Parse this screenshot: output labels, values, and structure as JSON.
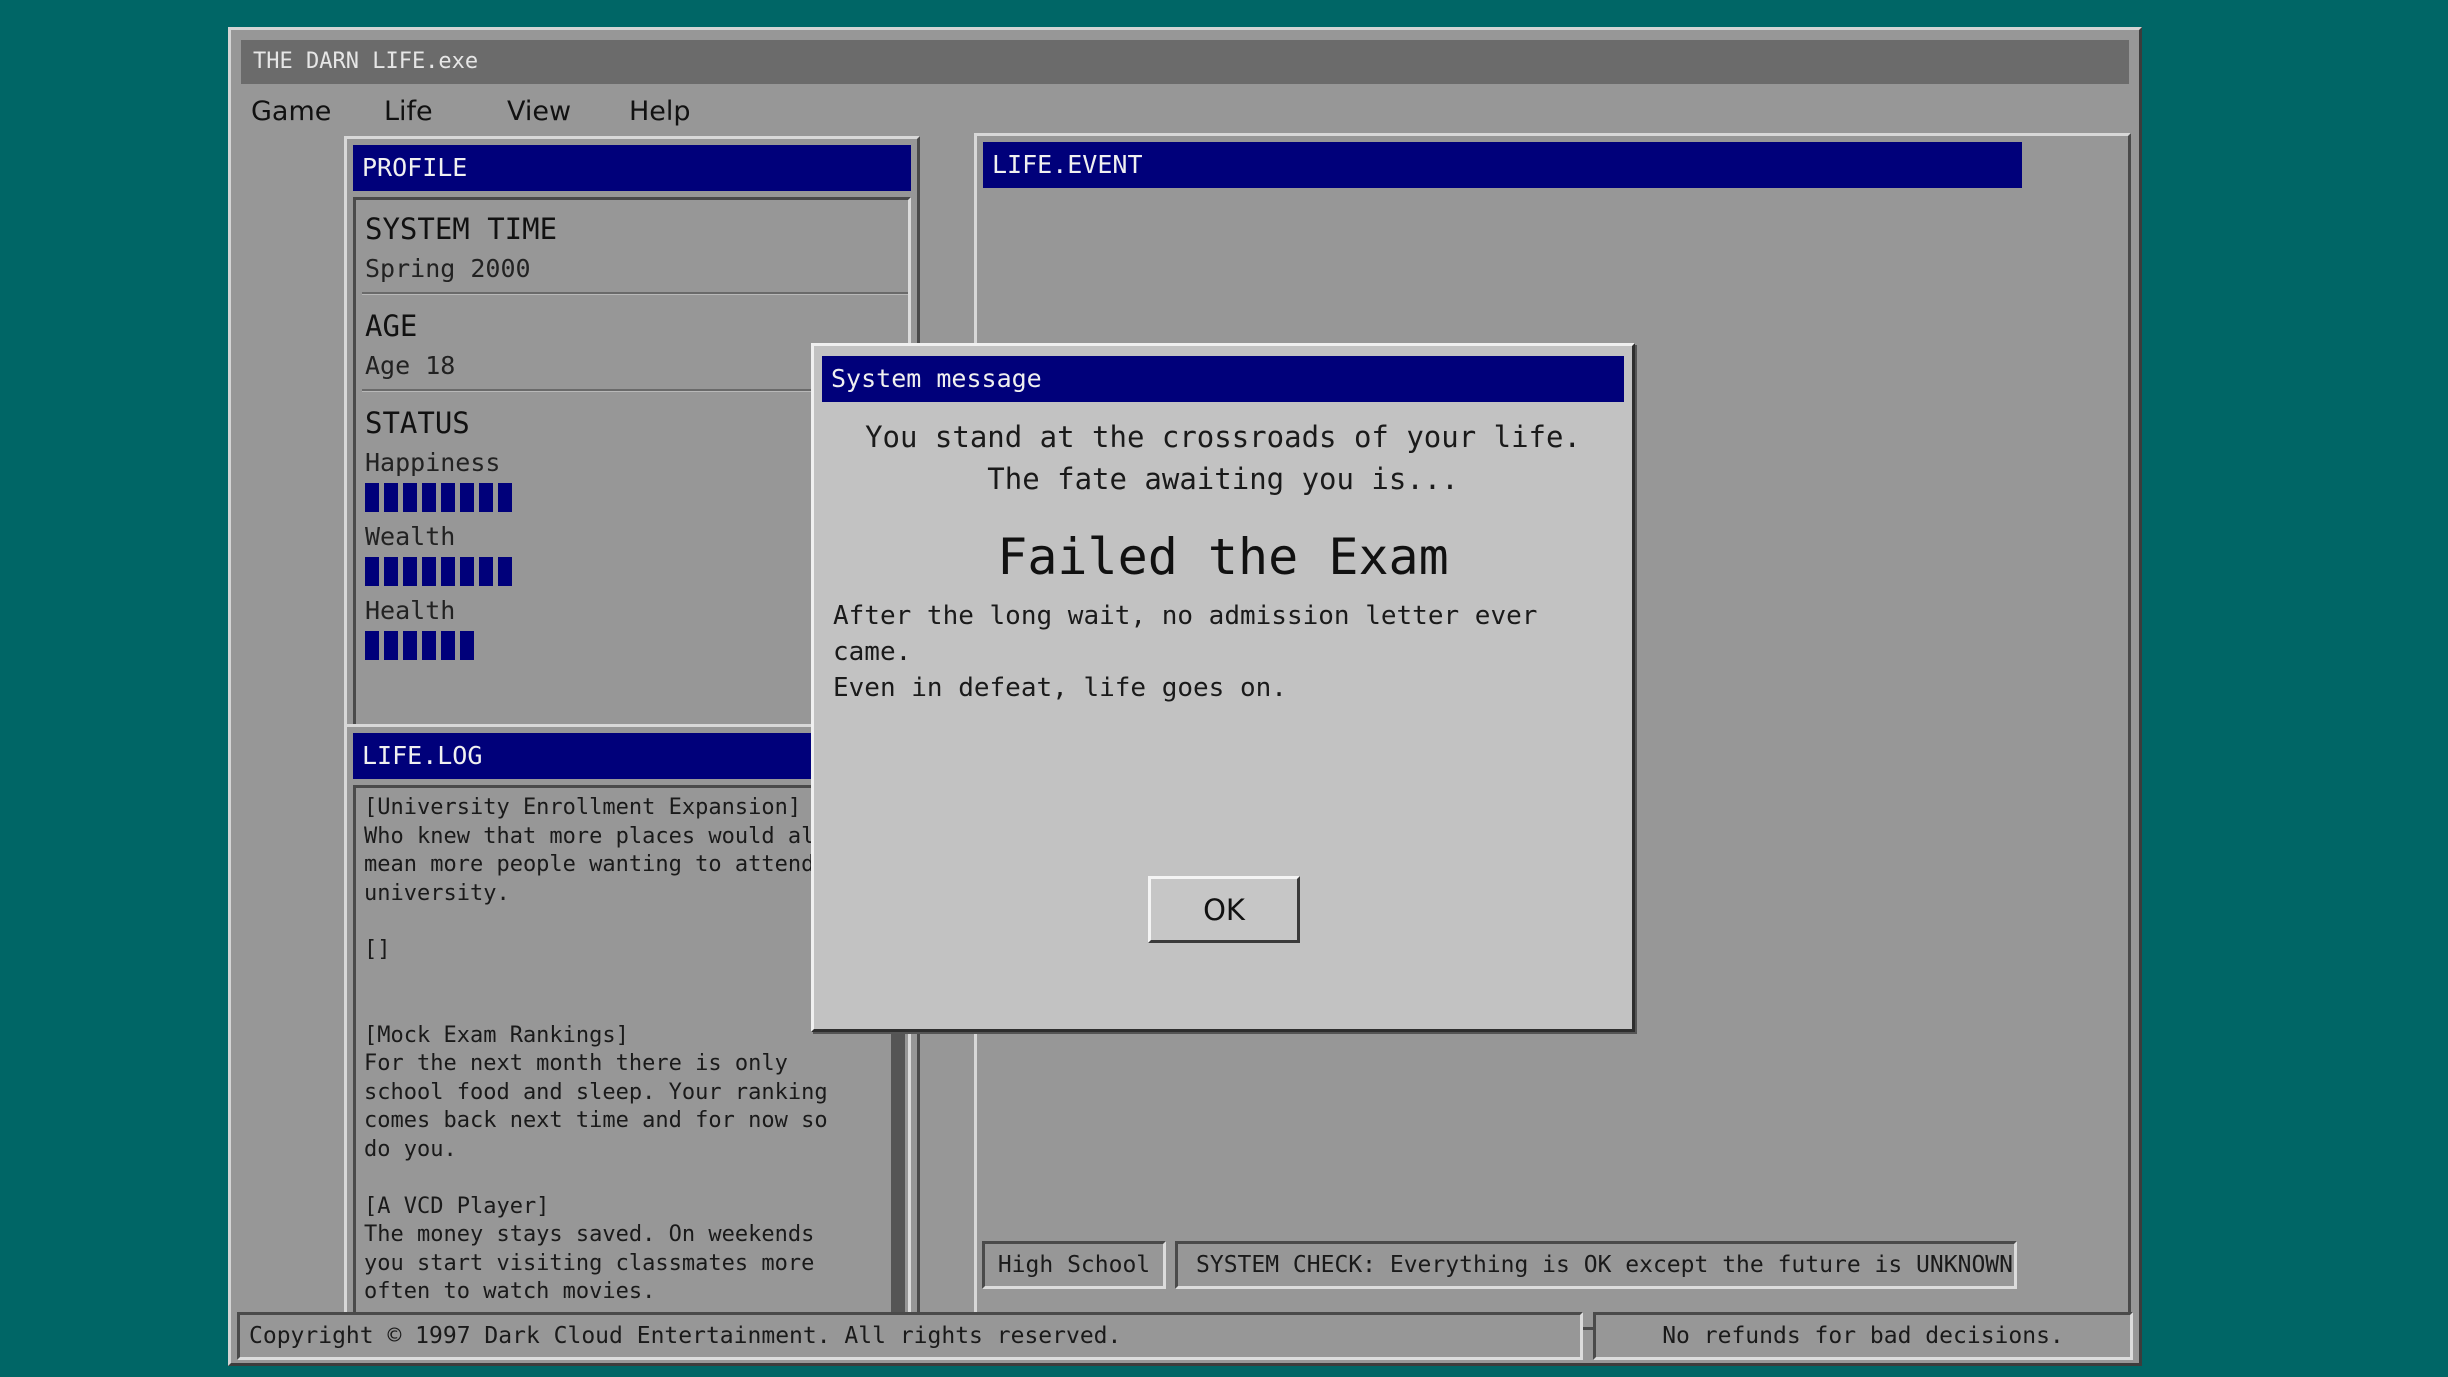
{
  "window": {
    "title": "THE DARN LIFE.exe"
  },
  "menu": [
    "Game",
    "Life",
    "View",
    "Help"
  ],
  "profile": {
    "header": "PROFILE",
    "system_time_title": "SYSTEM TIME",
    "system_time_value": "Spring 2000",
    "age_title": "AGE",
    "age_value": "Age 18",
    "status_title": "STATUS",
    "stats": [
      {
        "label": "Happiness",
        "segments": 8
      },
      {
        "label": "Wealth",
        "segments": 8
      },
      {
        "label": "Health",
        "segments": 6
      }
    ]
  },
  "log": {
    "header": "LIFE.LOG",
    "entries": [
      {
        "title": "[University Enrollment Expansion]",
        "body": "Who knew that more places would also\nmean more people wanting to attend\nuniversity."
      },
      {
        "title": "[]",
        "body": ""
      },
      {
        "title": "[Mock Exam Rankings]",
        "body": "For the next month there is only\nschool food and sleep. Your ranking\ncomes back next time and for now so\ndo you."
      },
      {
        "title": "[A VCD Player]",
        "body": "The money stays saved. On weekends\nyou start visiting classmates more\noften to watch movies."
      }
    ]
  },
  "event": {
    "header": "LIFE.EVENT",
    "stage": "High School",
    "system_check": "SYSTEM CHECK: Everything is OK except the future is UNKNOWN."
  },
  "dialog": {
    "title": "System message",
    "intro_line1": "You stand at the crossroads of your life.",
    "intro_line2": "The fate awaiting you is...",
    "outcome": "Failed the Exam",
    "desc_line1": "After the long wait, no admission letter ever came.",
    "desc_line2": "Even in defeat, life goes on.",
    "ok_label": "OK"
  },
  "footer": {
    "copyright": "Copyright © 1997 Dark Cloud Entertainment. All rights reserved.",
    "tagline": "No refunds for bad decisions."
  },
  "colors": {
    "desktop": "#006666",
    "title_bar_blue": "#00007a",
    "window_gray": "#979797",
    "dialog_gray": "#c2c2c2"
  }
}
